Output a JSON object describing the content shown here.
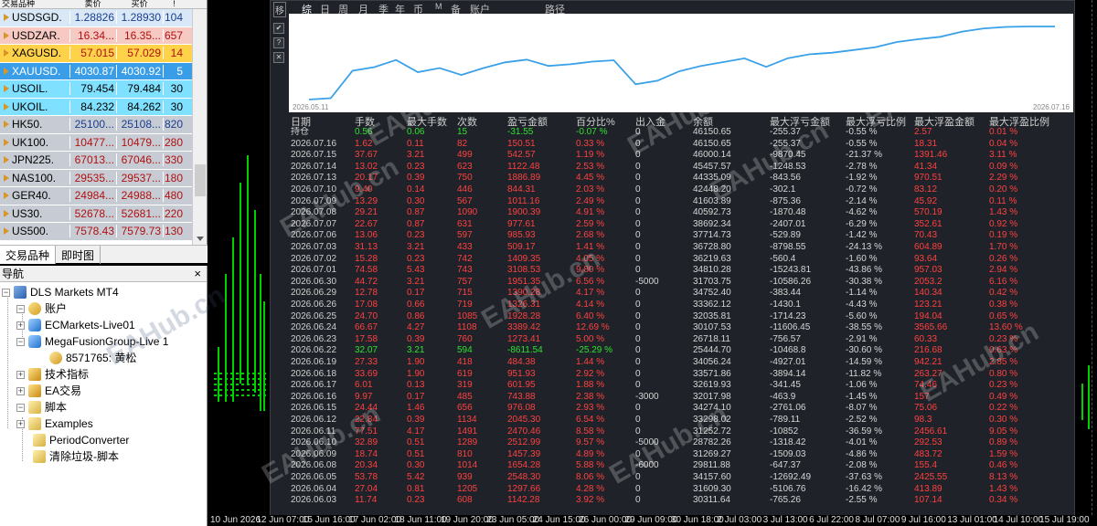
{
  "market_watch": {
    "header": {
      "symbol": "交易品种",
      "bid": "卖价",
      "ask": "买价",
      "spread": "!"
    },
    "rows": [
      {
        "symbol": "USDSGD.",
        "bid": "1.28826",
        "ask": "1.28930",
        "spread": "104",
        "bg": "#d9e8f7",
        "fg": "#1a3d8f"
      },
      {
        "symbol": "USDZAR.",
        "bid": "16.34...",
        "ask": "16.35...",
        "spread": "657",
        "bg": "#f7c9c3",
        "fg": "#b01010"
      },
      {
        "symbol": "XAGUSD.",
        "bid": "57.015",
        "ask": "57.029",
        "spread": "14",
        "bg": "#ffd24a",
        "fg": "#b01010"
      },
      {
        "symbol": "XAUUSD.",
        "bid": "4030.87",
        "ask": "4030.92",
        "spread": "5",
        "bg": "#3a9de8",
        "fg": "#ffffff"
      },
      {
        "symbol": "USOIL.",
        "bid": "79.454",
        "ask": "79.484",
        "spread": "30",
        "bg": "#7fe0ff",
        "fg": "#000000"
      },
      {
        "symbol": "UKOIL.",
        "bid": "84.232",
        "ask": "84.262",
        "spread": "30",
        "bg": "#7fe0ff",
        "fg": "#000000"
      },
      {
        "symbol": "HK50.",
        "bid": "25100...",
        "ask": "25108...",
        "spread": "820",
        "bg": "#c7ccd4",
        "fg": "#1a3d8f"
      },
      {
        "symbol": "UK100.",
        "bid": "10477...",
        "ask": "10479...",
        "spread": "280",
        "bg": "#c7ccd4",
        "fg": "#b01010"
      },
      {
        "symbol": "JPN225.",
        "bid": "67013...",
        "ask": "67046...",
        "spread": "330",
        "bg": "#c7ccd4",
        "fg": "#b01010"
      },
      {
        "symbol": "NAS100.",
        "bid": "29535...",
        "ask": "29537...",
        "spread": "180",
        "bg": "#c7ccd4",
        "fg": "#b01010"
      },
      {
        "symbol": "GER40.",
        "bid": "24984...",
        "ask": "24988...",
        "spread": "480",
        "bg": "#c7ccd4",
        "fg": "#b01010"
      },
      {
        "symbol": "US30.",
        "bid": "52678...",
        "ask": "52681...",
        "spread": "220",
        "bg": "#c7ccd4",
        "fg": "#b01010"
      },
      {
        "symbol": "US500.",
        "bid": "7578.43",
        "ask": "7579.73",
        "spread": "130",
        "bg": "#c7ccd4",
        "fg": "#b01010"
      }
    ],
    "tabs": [
      "交易品种",
      "即时图"
    ]
  },
  "navigator": {
    "title": "导航",
    "close": "×",
    "items": {
      "root": "DLS Markets MT4",
      "accounts": "账户",
      "acc1": "ECMarkets-Live01",
      "acc2": "MegaFusionGroup-Live 1",
      "user": "8571765: 黄松",
      "indicators": "技术指标",
      "ea": "EA交易",
      "scripts": "脚本",
      "s1": "Examples",
      "s2": "PeriodConverter",
      "s3": "清除垃圾-脚本"
    }
  },
  "panel": {
    "toolbar": {
      "icon": "移",
      "tabs": [
        "综",
        "日",
        "周",
        "月",
        "季",
        "年",
        "币",
        "M",
        "备",
        "账户",
        "路径"
      ]
    },
    "side_buttons": [
      "✔",
      "?",
      "✕"
    ],
    "graph": {
      "start_date": "2026.05.11",
      "end_date": "2026.07.16"
    },
    "columns": [
      "日期",
      "手数",
      "最大手数",
      "次数",
      "盈亏金额",
      "百分比%",
      "出入金",
      "余额",
      "最大浮亏金额",
      "最大浮亏比例",
      "最大浮盈金额",
      "最大浮盈比例"
    ],
    "rows": [
      [
        "持仓",
        "0.56",
        "0.06",
        "15",
        "-31.55",
        "-0.07 %",
        "0",
        "46150.65",
        "-255.37",
        "-0.55 %",
        "2.57",
        "0.01 %"
      ],
      [
        "2026.07.16",
        "1.62",
        "0.11",
        "82",
        "150.51",
        "0.33 %",
        "0",
        "46150.65",
        "-255.37",
        "-0.55 %",
        "18.31",
        "0.04 %"
      ],
      [
        "2026.07.15",
        "37.67",
        "3.21",
        "499",
        "542.57",
        "1.19 %",
        "0",
        "46000.14",
        "-9870.45",
        "-21.37 %",
        "1391.46",
        "3.11 %"
      ],
      [
        "2026.07.14",
        "13.02",
        "0.23",
        "623",
        "1122.48",
        "2.53 %",
        "0",
        "45457.57",
        "-1248.53",
        "-2.78 %",
        "41.34",
        "0.09 %"
      ],
      [
        "2026.07.13",
        "20.17",
        "0.39",
        "750",
        "1886.89",
        "4.45 %",
        "0",
        "44335.09",
        "-843.56",
        "-1.92 %",
        "970.51",
        "2.29 %"
      ],
      [
        "2026.07.10",
        "9.40",
        "0.14",
        "446",
        "844.31",
        "2.03 %",
        "0",
        "42448.20",
        "-302.1",
        "-0.72 %",
        "83.12",
        "0.20 %"
      ],
      [
        "2026.07.09",
        "13.29",
        "0.30",
        "567",
        "1011.16",
        "2.49 %",
        "0",
        "41603.89",
        "-875.36",
        "-2.14 %",
        "45.92",
        "0.11 %"
      ],
      [
        "2026.07.08",
        "29.21",
        "0.87",
        "1090",
        "1900.39",
        "4.91 %",
        "0",
        "40592.73",
        "-1870.48",
        "-4.62 %",
        "570.19",
        "1.43 %"
      ],
      [
        "2026.07.07",
        "22.67",
        "0.87",
        "631",
        "977.61",
        "2.59 %",
        "0",
        "38692.34",
        "-2407.01",
        "-6.29 %",
        "352.61",
        "0.92 %"
      ],
      [
        "2026.07.06",
        "13.06",
        "0.23",
        "597",
        "985.93",
        "2.68 %",
        "0",
        "37714.73",
        "-529.89",
        "-1.42 %",
        "70.43",
        "0.19 %"
      ],
      [
        "2026.07.03",
        "31.13",
        "3.21",
        "433",
        "509.17",
        "1.41 %",
        "0",
        "36728.80",
        "-8798.55",
        "-24.13 %",
        "604.89",
        "1.70 %"
      ],
      [
        "2026.07.02",
        "15.28",
        "0.23",
        "742",
        "1409.35",
        "4.05 %",
        "0",
        "36219.63",
        "-560.4",
        "-1.60 %",
        "93.64",
        "0.26 %"
      ],
      [
        "2026.07.01",
        "74.58",
        "5.43",
        "743",
        "3108.53",
        "9.80 %",
        "0",
        "34810.28",
        "-15243.81",
        "-43.86 %",
        "957.03",
        "2.94 %"
      ],
      [
        "2026.06.30",
        "44.72",
        "3.21",
        "757",
        "1951.35",
        "6.56 %",
        "-5000",
        "31703.75",
        "-10586.26",
        "-30.38 %",
        "2053.2",
        "6.16 %"
      ],
      [
        "2026.06.29",
        "12.78",
        "0.17",
        "715",
        "1390.28",
        "4.17 %",
        "0",
        "34752.40",
        "-383.44",
        "-1.14 %",
        "140.34",
        "0.42 %"
      ],
      [
        "2026.06.26",
        "17.08",
        "0.66",
        "719",
        "1326.31",
        "4.14 %",
        "0",
        "33362.12",
        "-1430.1",
        "-4.43 %",
        "123.21",
        "0.38 %"
      ],
      [
        "2026.06.25",
        "24.70",
        "0.86",
        "1085",
        "1928.28",
        "6.40 %",
        "0",
        "32035.81",
        "-1714.23",
        "-5.60 %",
        "194.04",
        "0.65 %"
      ],
      [
        "2026.06.24",
        "66.67",
        "4.27",
        "1108",
        "3389.42",
        "12.69 %",
        "0",
        "30107.53",
        "-11606.45",
        "-38.55 %",
        "3565.66",
        "13.60 %"
      ],
      [
        "2026.06.23",
        "17.58",
        "0.39",
        "760",
        "1273.41",
        "5.00 %",
        "0",
        "26718.11",
        "-756.57",
        "-2.91 %",
        "60.33",
        "0.23 %"
      ],
      [
        "2026.06.22",
        "32.07",
        "3.21",
        "594",
        "-8611.54",
        "-25.29 %",
        "0",
        "25444.70",
        "-10468.8",
        "-30.60 %",
        "216.68",
        "0.63 %"
      ],
      [
        "2026.06.19",
        "27.33",
        "1.90",
        "418",
        "484.38",
        "1.44 %",
        "0",
        "34056.24",
        "-4927.01",
        "-14.59 %",
        "942.21",
        "2.85 %"
      ],
      [
        "2026.06.18",
        "33.69",
        "1.90",
        "619",
        "951.93",
        "2.92 %",
        "0",
        "33571.86",
        "-3894.14",
        "-11.82 %",
        "263.27",
        "0.80 %"
      ],
      [
        "2026.06.17",
        "6.01",
        "0.13",
        "319",
        "601.95",
        "1.88 %",
        "0",
        "32619.93",
        "-341.45",
        "-1.06 %",
        "74.46",
        "0.23 %"
      ],
      [
        "2026.06.16",
        "9.97",
        "0.17",
        "485",
        "743.88",
        "2.38 %",
        "-3000",
        "32017.98",
        "-463.9",
        "-1.45 %",
        "157",
        "0.49 %"
      ],
      [
        "2026.06.15",
        "24.44",
        "1.46",
        "656",
        "976.08",
        "2.93 %",
        "0",
        "34274.10",
        "-2761.06",
        "-8.07 %",
        "75.06",
        "0.22 %"
      ],
      [
        "2026.06.12",
        "22.84",
        "0.39",
        "1134",
        "2045.30",
        "6.54 %",
        "0",
        "33298.02",
        "-789.11",
        "-2.52 %",
        "98.3",
        "0.30 %"
      ],
      [
        "2026.06.11",
        "77.51",
        "4.17",
        "1491",
        "2470.46",
        "8.58 %",
        "0",
        "31252.72",
        "-10852",
        "-36.59 %",
        "2456.61",
        "9.05 %"
      ],
      [
        "2026.06.10",
        "32.89",
        "0.51",
        "1289",
        "2512.99",
        "9.57 %",
        "-5000",
        "28782.26",
        "-1318.42",
        "-4.01 %",
        "292.53",
        "0.89 %"
      ],
      [
        "2026.06.09",
        "18.74",
        "0.51",
        "810",
        "1457.39",
        "4.89 %",
        "0",
        "31269.27",
        "-1509.03",
        "-4.86 %",
        "483.72",
        "1.59 %"
      ],
      [
        "2026.06.08",
        "20.34",
        "0.30",
        "1014",
        "1654.28",
        "5.88 %",
        "-6000",
        "29811.88",
        "-647.37",
        "-2.08 %",
        "155.4",
        "0.46 %"
      ],
      [
        "2026.06.05",
        "53.78",
        "5.42",
        "939",
        "2548.30",
        "8.06 %",
        "0",
        "34157.60",
        "-12692.49",
        "-37.63 %",
        "2425.55",
        "8.13 %"
      ],
      [
        "2026.06.04",
        "27.04",
        "0.81",
        "1205",
        "1297.66",
        "4.28 %",
        "0",
        "31609.30",
        "-5106.76",
        "-16.42 %",
        "413.89",
        "1.43 %"
      ],
      [
        "2026.06.03",
        "11.74",
        "0.23",
        "608",
        "1142.28",
        "3.92 %",
        "0",
        "30311.64",
        "-765.26",
        "-2.55 %",
        "107.14",
        "0.34 %"
      ]
    ]
  },
  "x_axis": [
    "10 Jun 2026",
    "12 Jun 07:00",
    "15 Jun 16:00",
    "17 Jun 02:00",
    "18 Jun 11:00",
    "19 Jun 20:00",
    "23 Jun 05:00",
    "24 Jun 15:00",
    "26 Jun 00:00",
    "29 Jun 09:00",
    "30 Jun 18:00",
    "2 Jul 03:00",
    "3 Jul 13:00",
    "6 Jul 22:00",
    "8 Jul 07:00",
    "9 Jul 16:00",
    "13 Jul 01:00",
    "14 Jul 10:00",
    "15 Jul 19:00"
  ],
  "watermark": "EAHub.cn",
  "colors": {
    "profit": "#ff4040",
    "loss": "#30e030",
    "panel_bg": "#1f2329",
    "curve": "#3aa0e8"
  }
}
